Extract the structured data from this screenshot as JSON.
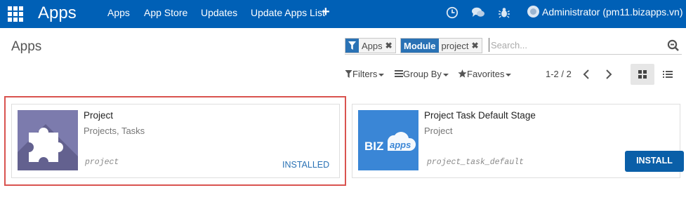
{
  "navbar": {
    "brand": "Apps",
    "menu": [
      "Apps",
      "App Store",
      "Updates",
      "Update Apps List"
    ],
    "plus_label": "+",
    "user_name": "Administrator (pm11.bizapps.vn)",
    "icons": [
      "apps-grid-icon",
      "clock-icon",
      "chat-icon",
      "bug-icon",
      "avatar"
    ]
  },
  "breadcrumb": "Apps",
  "search": {
    "facets": [
      {
        "label": "",
        "value": "Apps",
        "icon": "filter-icon"
      },
      {
        "label": "Module",
        "value": "project"
      }
    ],
    "remove_glyph": "✖",
    "placeholder": "Search..."
  },
  "controls": {
    "filters": "Filters",
    "group_by": "Group By",
    "favorites": "Favorites",
    "pager": "1-2 / 2"
  },
  "cards": [
    {
      "title": "Project",
      "subtitle": "Projects, Tasks",
      "technical_name": "project",
      "status": "INSTALLED",
      "icon": "puzzle-icon"
    },
    {
      "title": "Project Task Default Stage",
      "subtitle": "Project",
      "technical_name": "project_task_default",
      "action": "INSTALL",
      "logo_text": "BIZapps"
    }
  ],
  "colors": {
    "navbar": "#0060b6",
    "facet_label": "#2a72b5",
    "highlight": "#d9534f",
    "install_button": "#0a5fa8",
    "puzzle_tile": "#7c7bad",
    "bizapps_tile": "#3a86d6"
  }
}
